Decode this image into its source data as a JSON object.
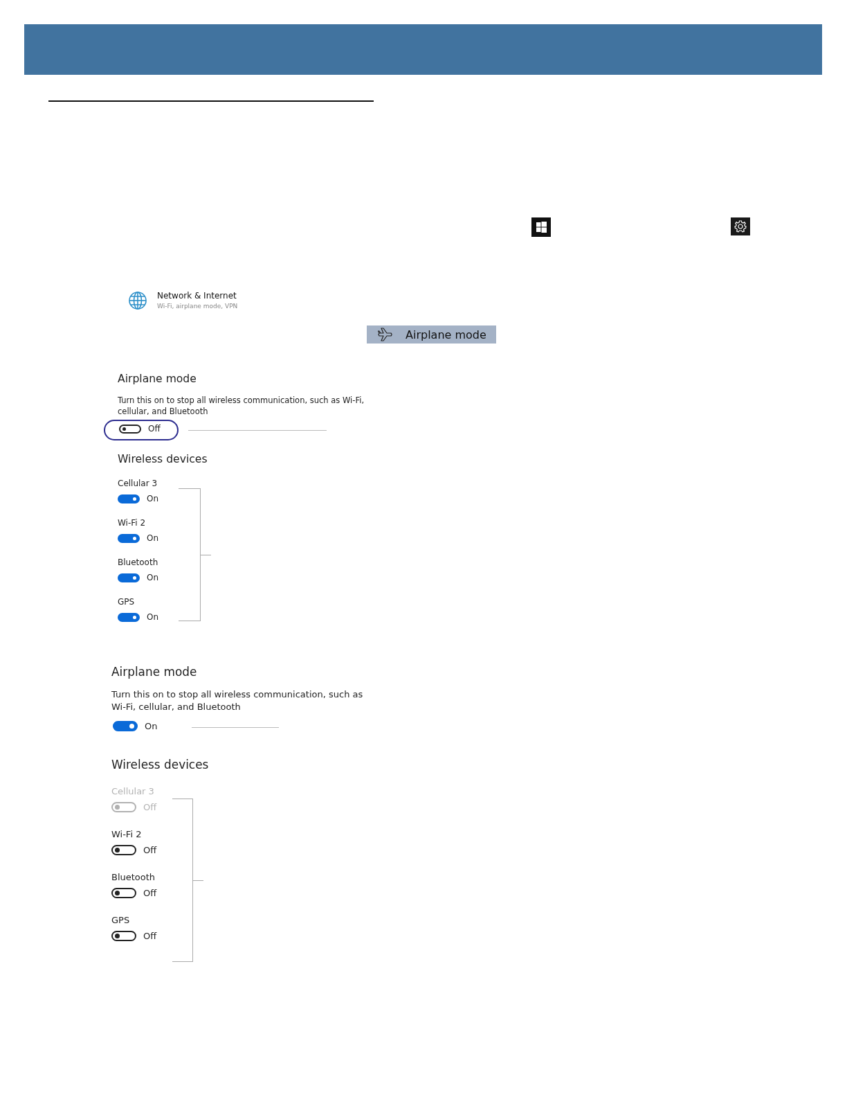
{
  "network_item": {
    "title": "Network & Internet",
    "subtitle": "Wi-Fi, airplane mode, VPN"
  },
  "airplane_button": {
    "label": "Airplane mode"
  },
  "panels": [
    {
      "title": "Airplane mode",
      "description": "Turn this on to stop all wireless communication, such as Wi-Fi, cellular, and Bluetooth",
      "toggle": {
        "on": false,
        "state": "Off",
        "highlighted": true
      },
      "devices_title": "Wireless devices",
      "devices": [
        {
          "name": "Cellular 3",
          "on": true,
          "state": "On",
          "disabled": false
        },
        {
          "name": "Wi-Fi 2",
          "on": true,
          "state": "On",
          "disabled": false
        },
        {
          "name": "Bluetooth",
          "on": true,
          "state": "On",
          "disabled": false
        },
        {
          "name": "GPS",
          "on": true,
          "state": "On",
          "disabled": false
        }
      ]
    },
    {
      "title": "Airplane mode",
      "description": "Turn this on to stop all wireless communication, such as Wi-Fi, cellular, and Bluetooth",
      "toggle": {
        "on": true,
        "state": "On",
        "highlighted": false
      },
      "devices_title": "Wireless devices",
      "devices": [
        {
          "name": "Cellular 3",
          "on": false,
          "state": "Off",
          "disabled": true
        },
        {
          "name": "Wi-Fi 2",
          "on": false,
          "state": "Off",
          "disabled": false
        },
        {
          "name": "Bluetooth",
          "on": false,
          "state": "Off",
          "disabled": false
        },
        {
          "name": "GPS",
          "on": false,
          "state": "Off",
          "disabled": false
        }
      ]
    }
  ]
}
